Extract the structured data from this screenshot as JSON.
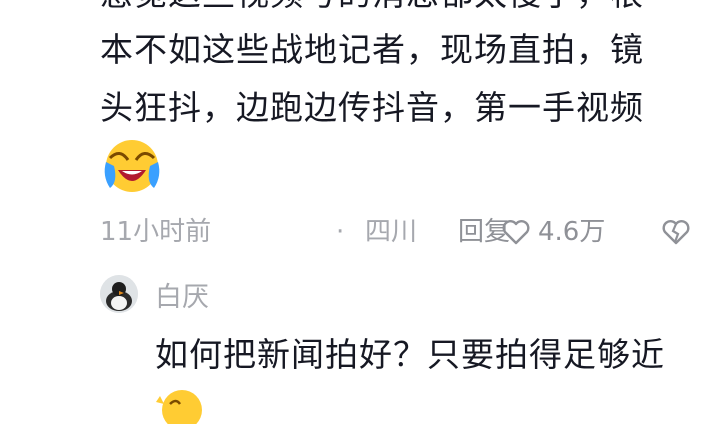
{
  "comment": {
    "lines": [
      "感觉这些视频号的消息都太慢了，根",
      "本不如这些战地记者，现场直拍，镜",
      "头狂抖，边跑边传抖音，第一手视频"
    ],
    "emoji": "laughing-crying-emoji"
  },
  "meta": {
    "time": "11小时前",
    "separator": "·",
    "location": "四川",
    "reply_label": "回复",
    "like_count": "4.6万",
    "like_icon": "heart-outline-icon",
    "dislike_icon": "broken-heart-icon"
  },
  "reply": {
    "username": "白厌",
    "text": "如何把新闻拍好？只要拍得足够近"
  },
  "colors": {
    "text": "#161823",
    "meta": "#a6a8ae",
    "emoji_yellow": "#ffcc33",
    "emoji_blue": "#3aa0ff"
  }
}
